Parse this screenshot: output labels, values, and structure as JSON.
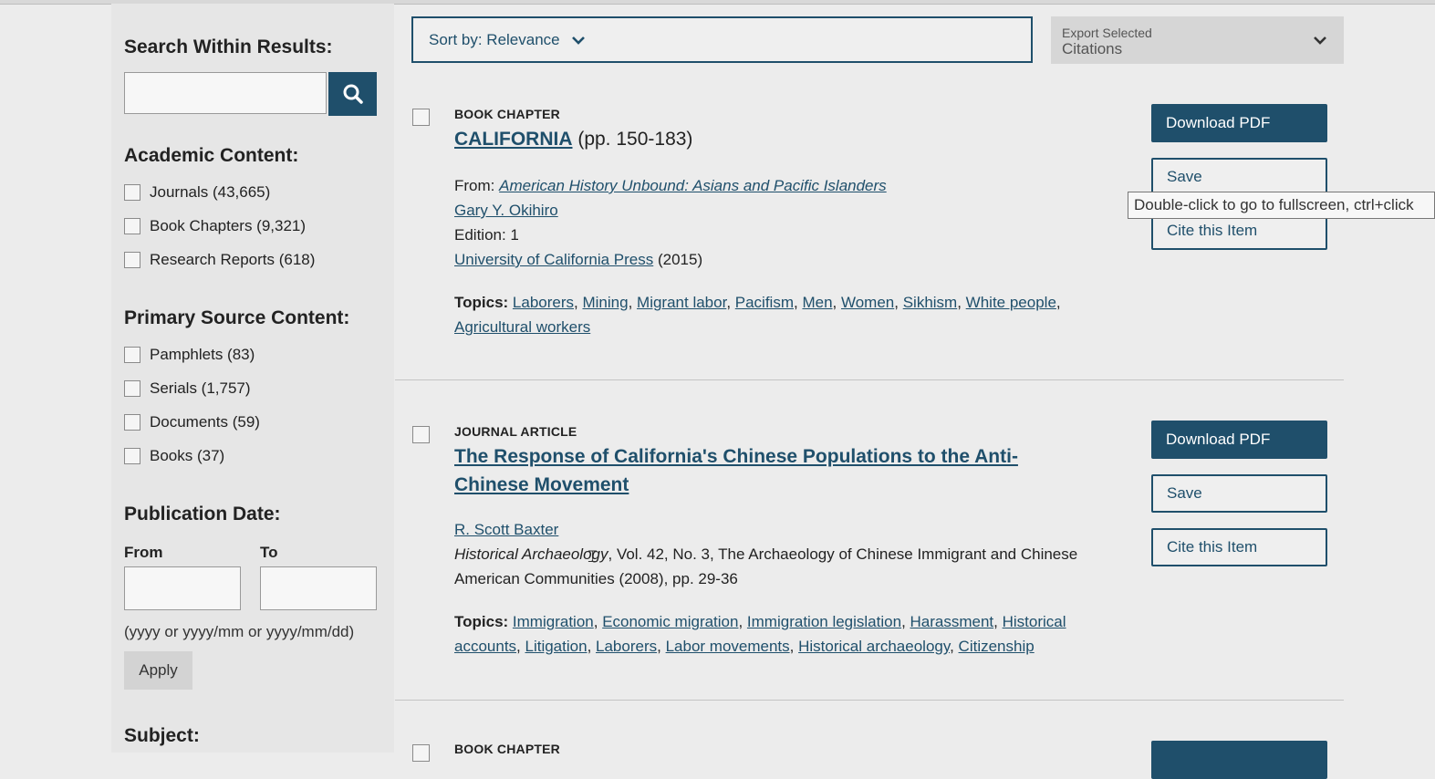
{
  "sidebar": {
    "search_heading": "Search Within Results:",
    "academic_heading": "Academic Content:",
    "academic_items": [
      {
        "label": "Journals (43,665)"
      },
      {
        "label": "Book Chapters (9,321)"
      },
      {
        "label": "Research Reports (618)"
      }
    ],
    "primary_heading": "Primary Source Content:",
    "primary_items": [
      {
        "label": "Pamphlets (83)"
      },
      {
        "label": "Serials (1,757)"
      },
      {
        "label": "Documents (59)"
      },
      {
        "label": "Books (37)"
      }
    ],
    "date_heading": "Publication Date:",
    "from_label": "From",
    "to_label": "To",
    "date_hint": "(yyyy or yyyy/mm or yyyy/mm/dd)",
    "apply_label": "Apply",
    "subject_heading": "Subject:"
  },
  "toolbar": {
    "sort_label": "Sort by: Relevance",
    "export_line1": "Export Selected",
    "export_line2": "Citations"
  },
  "results": [
    {
      "type": "BOOK CHAPTER",
      "title": "CALIFORNIA",
      "pages": " (pp. 150-183)",
      "from_label": "From: ",
      "from_link": "American History Unbound: Asians and Pacific Islanders",
      "author": "Gary Y. Okihiro",
      "edition": "Edition: 1",
      "publisher": "University of California Press",
      "year": " (2015)",
      "topics_label": "Topics:",
      "topics": [
        "Laborers",
        "Mining",
        "Migrant labor",
        "Pacifism",
        "Men",
        "Women",
        "Sikhism",
        "White people",
        "Agricultural workers"
      ],
      "download_label": "Download PDF",
      "save_label": "Save",
      "cite_label": "Cite this Item"
    },
    {
      "type": "JOURNAL ARTICLE",
      "title_line1": "The Response of California's Chinese Populations to the Anti-",
      "title_line2": "Chinese Movement",
      "author": "R. Scott Baxter",
      "journal": "Historical Archaeology",
      "citation_rest": ", Vol. 42, No. 3, The Archaeology of Chinese Immigrant and Chinese",
      "citation_line2": "American Communities (2008), pp. 29-36",
      "topics_label": "Topics:",
      "topics": [
        "Immigration",
        "Economic migration",
        "Immigration legislation",
        "Harassment",
        "Historical accounts",
        "Litigation",
        "Laborers",
        "Labor movements",
        "Historical archaeology",
        "Citizenship"
      ],
      "download_label": "Download PDF",
      "save_label": "Save",
      "cite_label": "Cite this Item"
    },
    {
      "type": "BOOK CHAPTER"
    }
  ],
  "tooltip": "Double-click to go to fullscreen, ctrl+click"
}
